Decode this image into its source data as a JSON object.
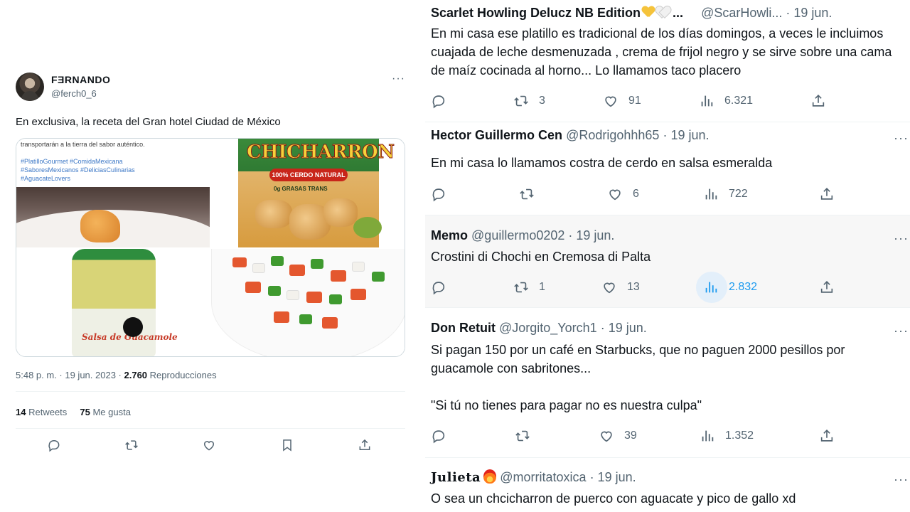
{
  "main_tweet": {
    "author_name": "FƎRNANDO",
    "author_handle": "@ferch0_6",
    "more": "···",
    "text": "En exclusiva, la receta del Gran hotel Ciudad de México",
    "media": {
      "caption": "transportarán a la tierra del sabor auténtico.",
      "hashtags": [
        "#PlatilloGourmet #ComidaMexicana",
        "#SaboresMexicanos #DeliciasCulinarias",
        "#AguacateLovers"
      ],
      "bag_brand": "CHICHARRON",
      "bag_badge": "100% CERDO NATURAL",
      "bag_badge2": "0g GRASAS TRANS",
      "jar_label": "Salsa de Guacamole"
    },
    "time": "5:48 p. m. · 19 jun. 2023 ·",
    "views": "2.760",
    "views_label": "Reproducciones",
    "retweets": "14",
    "retweets_label": "Retweets",
    "likes": "75",
    "likes_label": "Me gusta"
  },
  "replies": [
    {
      "name": "Scarlet Howling Delucz NB Edition",
      "name_suffix": " ...",
      "handle": "@ScarHowli...",
      "date": "· 19 jun.",
      "text": "En mi casa ese platillo es tradicional de los días domingos, a veces le incluimos cuajada de leche desmenuzada , crema de frijol negro y se sirve sobre una cama de maíz cocinada al horno... Lo llamamos taco placero",
      "retweets": "3",
      "likes": "91",
      "views": "6.321"
    },
    {
      "name": "Hector Guillermo Cen",
      "handle": "@Rodrigohhh65",
      "date": "· 19 jun.",
      "text": "En mi casa lo llamamos costra  de cerdo en salsa esmeralda",
      "retweets": "",
      "likes": "6",
      "views": "722"
    },
    {
      "name": "Memo",
      "handle": "@guillermo0202",
      "date": "· 19 jun.",
      "text": "Crostini di Chochi en Cremosa di Palta",
      "retweets": "1",
      "likes": "13",
      "views": "2.832"
    },
    {
      "name": "Don Retuit",
      "handle": "@Jorgito_Yorch1",
      "date": "· 19 jun.",
      "text": "Si pagan 150 por un café en Starbucks, que no paguen 2000 pesillos por guacamole con sabritones...\n\n\"Si tú no tienes para pagar no es nuestra culpa\"",
      "retweets": "",
      "likes": "39",
      "views": "1.352"
    },
    {
      "name": "Julieta",
      "handle": "@morritatoxica",
      "date": "· 19 jun.",
      "text": "O sea un chcicharron de puerco con aguacate y pico de gallo xd"
    }
  ],
  "colors": {
    "accent": "#1d9bf0",
    "muted": "#536471",
    "text": "#0f1419",
    "highlight_bg": "#f7f7f7"
  },
  "icons": [
    "reply-icon",
    "retweet-icon",
    "like-icon",
    "views-icon",
    "share-icon",
    "bookmark-icon",
    "more-icon"
  ]
}
